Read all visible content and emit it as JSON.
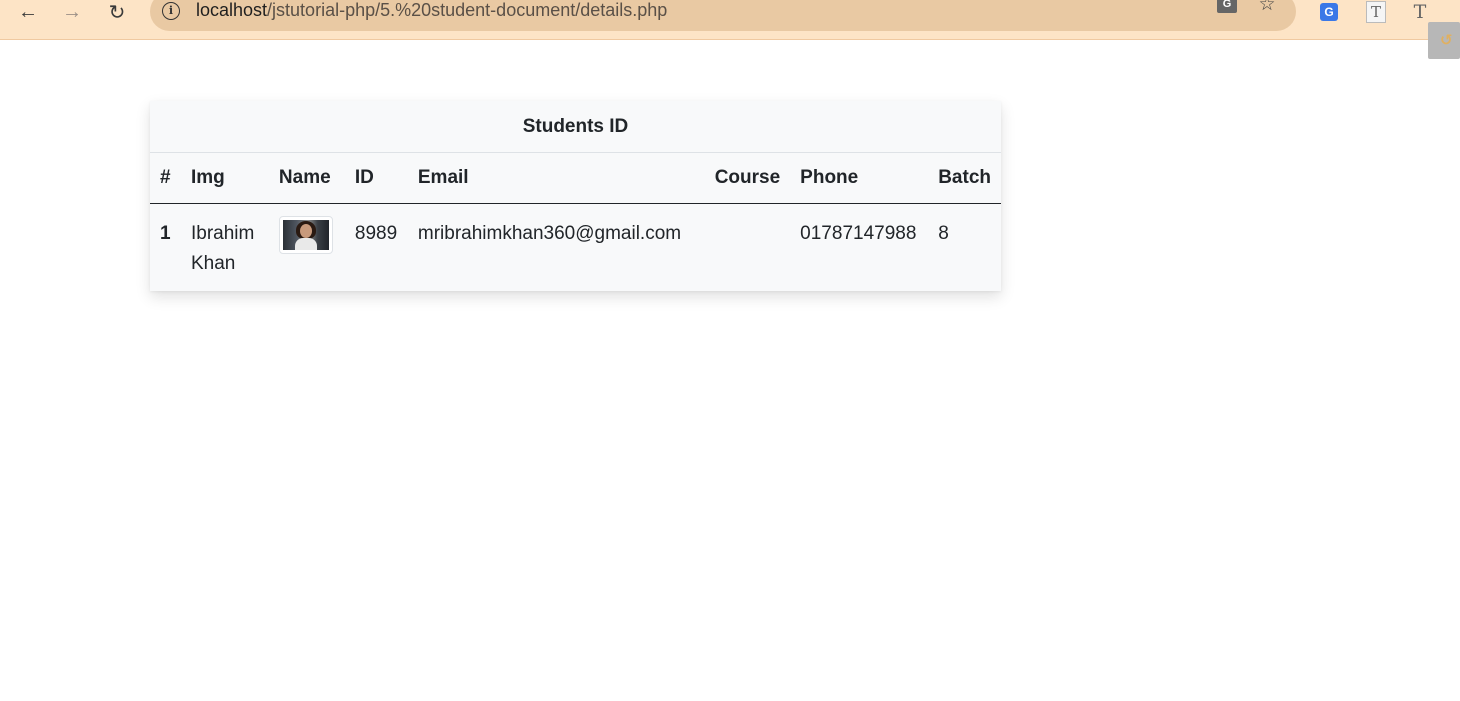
{
  "browser": {
    "url_host": "localhost",
    "url_path": "/jstutorial-php/5.%20student-document/details.php",
    "icons": {
      "back": "arrow-left-icon",
      "forward": "arrow-right-icon",
      "reload": "reload-icon",
      "info": "info-icon",
      "translate": "translate-icon",
      "bookmark": "star-icon"
    },
    "extensions": [
      "google-translate-extension-icon",
      "text-extension-icon",
      "text-extension-icon"
    ]
  },
  "table": {
    "caption": "Students ID",
    "headers": [
      "#",
      "Img",
      "Name",
      "ID",
      "Email",
      "Course",
      "Phone",
      "Batch"
    ],
    "rows": [
      {
        "index": "1",
        "img_col": "Ibrahim Khan",
        "name_col": "student-photo",
        "id": "8989",
        "email": "mribrahimkhan360@gmail.com",
        "course": "",
        "phone": "01787147988",
        "batch": "8"
      }
    ]
  }
}
